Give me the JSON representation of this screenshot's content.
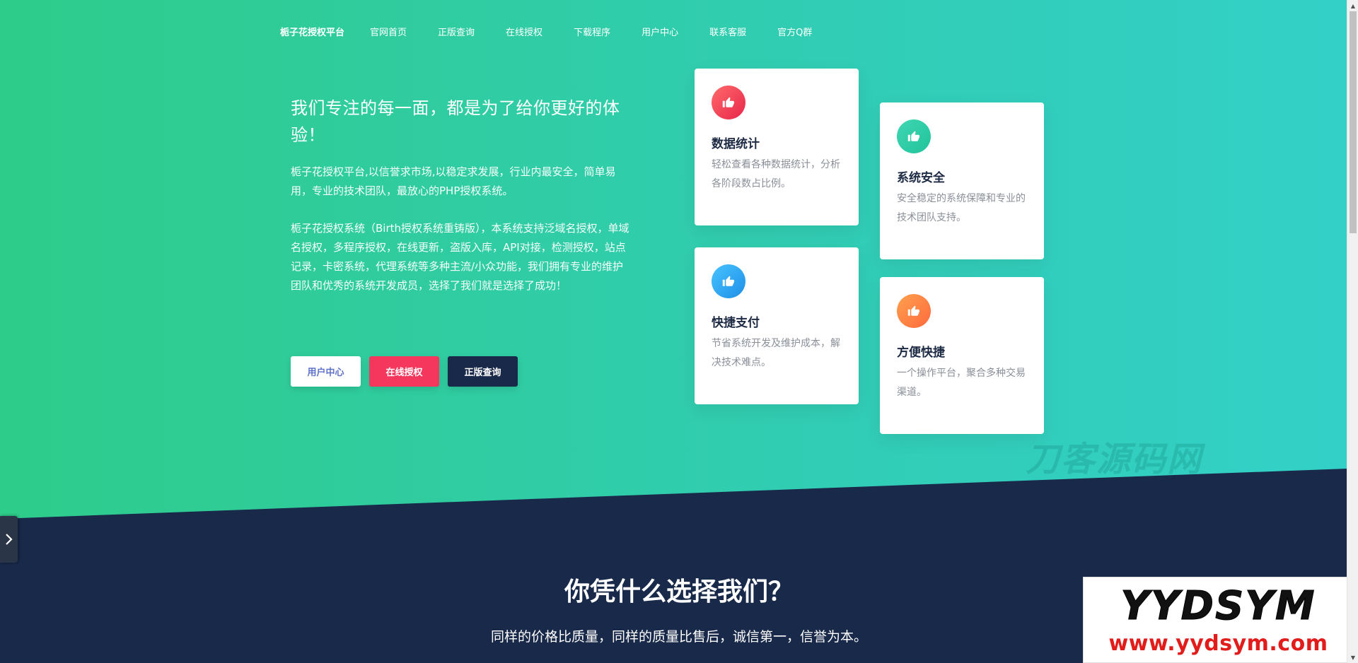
{
  "nav": {
    "brand": "栀子花授权平台",
    "items": [
      "官网首页",
      "正版查询",
      "在线授权",
      "下载程序",
      "用户中心",
      "联系客服",
      "官方Q群"
    ]
  },
  "hero": {
    "title": "我们专注的每一面，都是为了给你更好的体验！",
    "para1": "栀子花授权平台,以信誉求市场,以稳定求发展，行业内最安全，简单易用，专业的技术团队，最放心的PHP授权系统。",
    "para2": "栀子花授权系统（Birth授权系统重铸版），本系统支持泛域名授权，单域名授权，多程序授权，在线更新，盗版入库，API对接，检测授权，站点记录，卡密系统，代理系统等多种主流/小众功能，我们拥有专业的维护团队和优秀的系统开发成员，选择了我们就是选择了成功！",
    "buttons": {
      "user_center": "用户中心",
      "online_auth": "在线授权",
      "genuine_query": "正版查询"
    }
  },
  "cards": [
    {
      "title": "数据统计",
      "desc": "轻松查看各种数据统计，分析各阶段数占比例。",
      "icon": "thumbs-up-icon"
    },
    {
      "title": "系统安全",
      "desc": "安全稳定的系统保障和专业的技术团队支持。",
      "icon": "thumbs-up-icon"
    },
    {
      "title": "快捷支付",
      "desc": "节省系统开发及维护成本，解决技术难点。",
      "icon": "thumbs-up-icon"
    },
    {
      "title": "方便快捷",
      "desc": "一个操作平台，聚合多种交易渠道。",
      "icon": "thumbs-up-icon"
    }
  ],
  "watermark": "刀客源码网",
  "why": {
    "title": "你凭什么选择我们？",
    "subtitle": "同样的价格比质量，同样的质量比售后，诚信第一，信誉为本。"
  },
  "logo": {
    "top": "YYDSYM",
    "bottom": "www.yydsym.com"
  },
  "colors": {
    "gradient_start": "#2ecc8a",
    "gradient_end": "#33d0c8",
    "dark": "#19294a",
    "accent_red": "#f6375d",
    "button_blue_text": "#5f72c9"
  }
}
